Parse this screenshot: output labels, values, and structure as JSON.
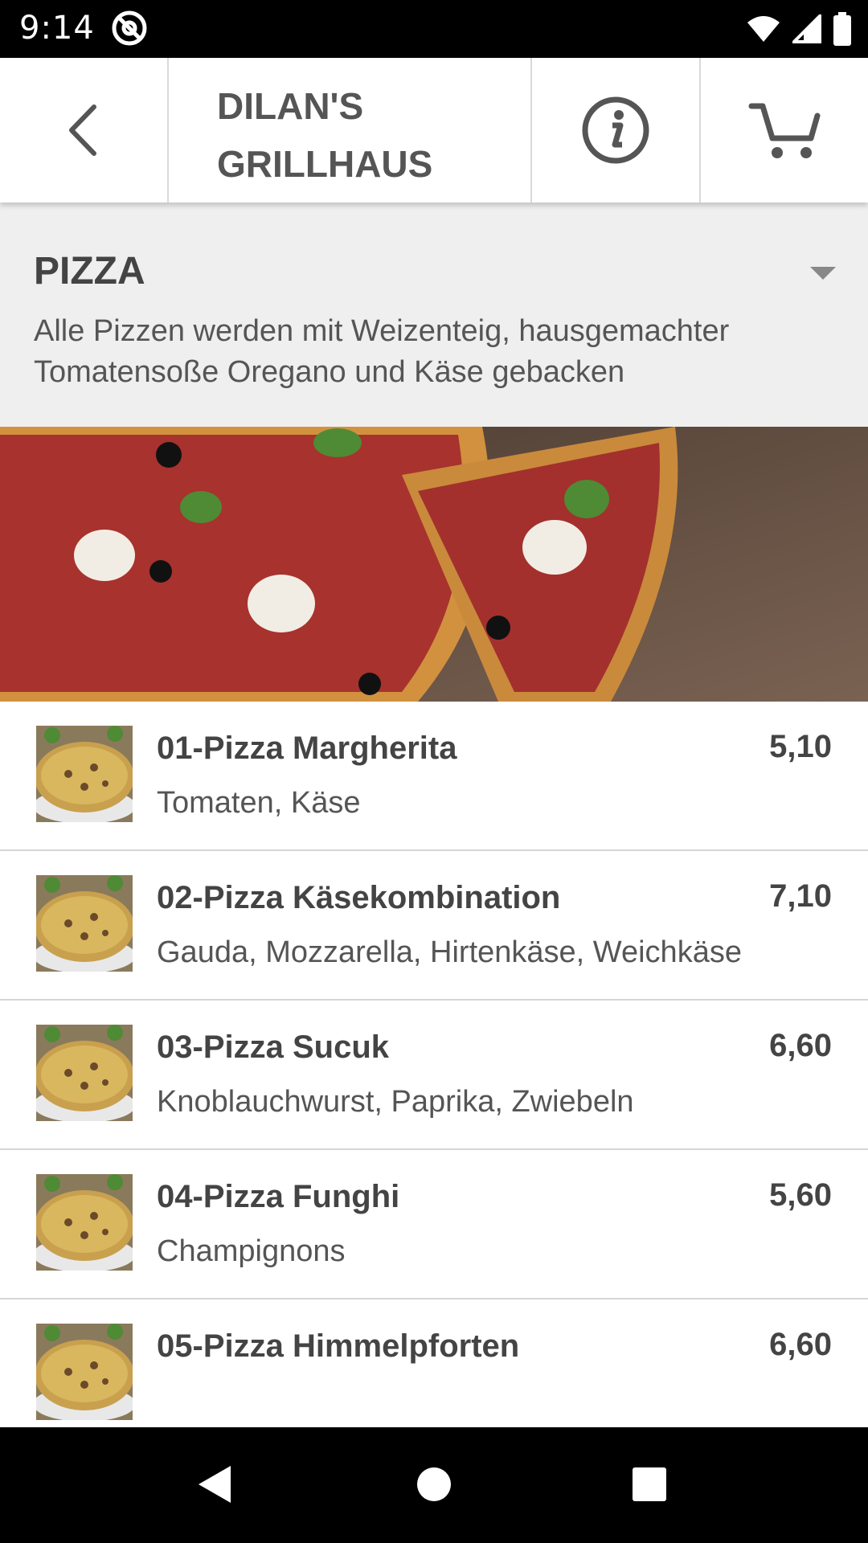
{
  "status_bar": {
    "time": "9:14"
  },
  "header": {
    "title_line1": "DILAN'S",
    "title_line2": "GRILLHAUS",
    "back_icon": "chevron-left-icon",
    "info_icon": "info-icon",
    "cart_icon": "cart-icon"
  },
  "category": {
    "title": "PIZZA",
    "description": "Alle Pizzen werden mit Weizenteig, hausgemachter Tomatensoße Oregano und Käse gebacken"
  },
  "items": [
    {
      "name": "01-Pizza Margherita",
      "desc": "Tomaten, Käse",
      "price": "5,10"
    },
    {
      "name": "02-Pizza Käsekombination",
      "desc": "Gauda, Mozzarella, Hirtenkäse, Weichkäse",
      "price": "7,10"
    },
    {
      "name": "03-Pizza Sucuk",
      "desc": "Knoblauchwurst, Paprika, Zwiebeln",
      "price": "6,60"
    },
    {
      "name": "04-Pizza Funghi",
      "desc": "Champignons",
      "price": "5,60"
    },
    {
      "name": "05-Pizza Himmelpforten",
      "desc": "",
      "price": "6,60"
    }
  ],
  "colors": {
    "header_bg": "#ffffff",
    "category_bg": "#efefef",
    "text_dark": "#444444"
  }
}
